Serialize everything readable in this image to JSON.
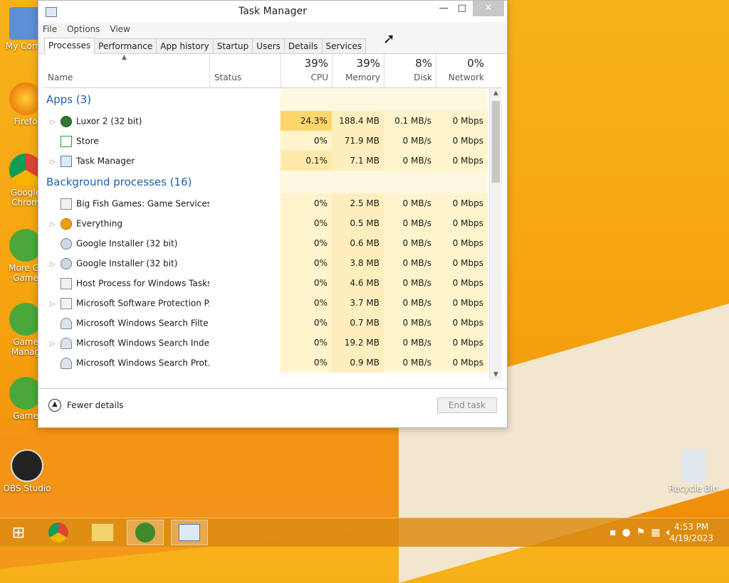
{
  "window": {
    "title": "Task Manager",
    "controls": {
      "minimize": "—",
      "maximize": "□",
      "close": "✕"
    }
  },
  "menu": [
    "File",
    "Options",
    "View"
  ],
  "tabs": [
    "Processes",
    "Performance",
    "App history",
    "Startup",
    "Users",
    "Details",
    "Services"
  ],
  "columns": {
    "name": "Name",
    "status": "Status",
    "cpu": {
      "label": "CPU",
      "percent": "39%"
    },
    "memory": {
      "label": "Memory",
      "percent": "39%"
    },
    "disk": {
      "label": "Disk",
      "percent": "8%"
    },
    "network": {
      "label": "Network",
      "percent": "0%"
    }
  },
  "groups": {
    "apps": "Apps (3)",
    "background": "Background processes (16)"
  },
  "rows": [
    {
      "name": "Luxor 2 (32 bit)",
      "cpu": "24.3%",
      "mem": "188.4 MB",
      "disk": "0.1 MB/s",
      "net": "0 Mbps"
    },
    {
      "name": "Store",
      "cpu": "0%",
      "mem": "71.9 MB",
      "disk": "0 MB/s",
      "net": "0 Mbps"
    },
    {
      "name": "Task Manager",
      "cpu": "0.1%",
      "mem": "7.1 MB",
      "disk": "0 MB/s",
      "net": "0 Mbps"
    },
    {
      "name": "Big Fish Games: Game Services ...",
      "cpu": "0%",
      "mem": "2.5 MB",
      "disk": "0 MB/s",
      "net": "0 Mbps"
    },
    {
      "name": "Everything",
      "cpu": "0%",
      "mem": "0.5 MB",
      "disk": "0 MB/s",
      "net": "0 Mbps"
    },
    {
      "name": "Google Installer (32 bit)",
      "cpu": "0%",
      "mem": "0.6 MB",
      "disk": "0 MB/s",
      "net": "0 Mbps"
    },
    {
      "name": "Google Installer (32 bit)",
      "cpu": "0%",
      "mem": "3.8 MB",
      "disk": "0 MB/s",
      "net": "0 Mbps"
    },
    {
      "name": "Host Process for Windows Tasks",
      "cpu": "0%",
      "mem": "4.6 MB",
      "disk": "0 MB/s",
      "net": "0 Mbps"
    },
    {
      "name": "Microsoft Software Protection P...",
      "cpu": "0%",
      "mem": "3.7 MB",
      "disk": "0 MB/s",
      "net": "0 Mbps"
    },
    {
      "name": "Microsoft Windows Search Filte...",
      "cpu": "0%",
      "mem": "0.7 MB",
      "disk": "0 MB/s",
      "net": "0 Mbps"
    },
    {
      "name": "Microsoft Windows Search Inde...",
      "cpu": "0%",
      "mem": "19.2 MB",
      "disk": "0 MB/s",
      "net": "0 Mbps"
    },
    {
      "name": "Microsoft Windows Search Prot...",
      "cpu": "0%",
      "mem": "0.9 MB",
      "disk": "0 MB/s",
      "net": "0 Mbps"
    }
  ],
  "footer": {
    "fewer_details": "Fewer details",
    "end_task": "End task"
  },
  "desktop_icons": [
    "My Comp",
    "Firefo",
    "Google Chrom",
    "More Gr Game",
    "Game Manag",
    "Game",
    "OBS Studio",
    "Recycle Bin"
  ],
  "taskbar": {
    "time": "4:53 PM",
    "date": "4/19/2023"
  },
  "colors": {
    "accent": "#1f5fa6",
    "cpu_hot": "#ffd66b",
    "heat_light": "#fff4cc",
    "taskbar": "#dc8c14"
  }
}
